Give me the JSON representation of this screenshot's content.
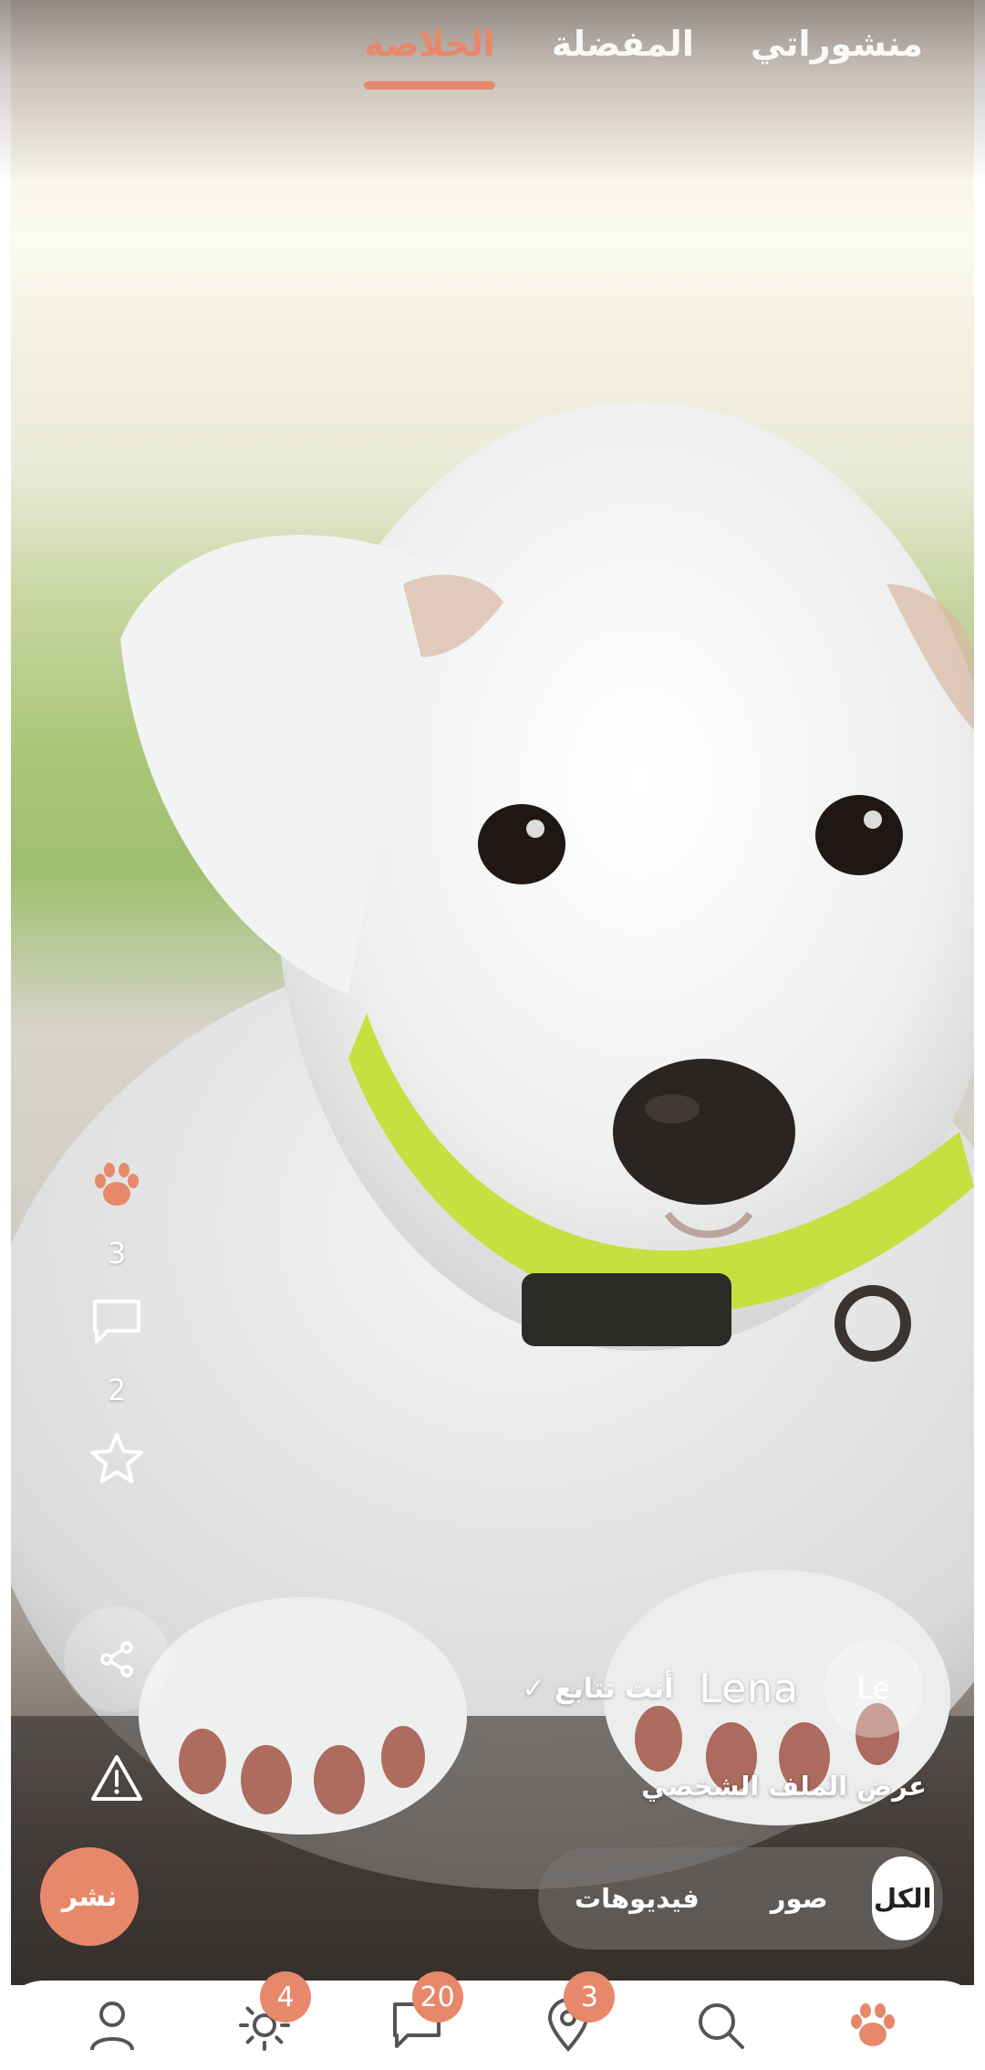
{
  "header": {
    "tabs": [
      {
        "label": "الخلاصة",
        "active": true
      },
      {
        "label": "المفضلة",
        "active": false
      },
      {
        "label": "منشوراتي",
        "active": false
      }
    ]
  },
  "post": {
    "image": "white-puppy-photo",
    "paws_count": "3",
    "comments_count": "2",
    "author": {
      "avatar_initials": "Le",
      "name": "Lena",
      "follow_status": "✓ أنت تتابع"
    },
    "profile_link": "عرض الملف الشخصي"
  },
  "actions": {
    "paw_icon": "paw-icon",
    "comment_icon": "comment-icon",
    "favorite_icon": "star-icon",
    "share_icon": "share-icon",
    "report_icon": "warning-icon"
  },
  "publish_button": "نشر",
  "filters": [
    {
      "label": "الكل",
      "active": true
    },
    {
      "label": "صور",
      "active": false
    },
    {
      "label": "فيديوهات",
      "active": false
    }
  ],
  "bottom_nav": [
    {
      "icon": "paw-icon",
      "badge": ""
    },
    {
      "icon": "search-icon",
      "badge": ""
    },
    {
      "icon": "location-icon",
      "badge": "3"
    },
    {
      "icon": "chat-icon",
      "badge": "20"
    },
    {
      "icon": "sun-icon",
      "badge": "4"
    },
    {
      "icon": "profile-icon",
      "badge": ""
    }
  ],
  "colors": {
    "accent": "#e8886a",
    "white": "#ffffff"
  }
}
